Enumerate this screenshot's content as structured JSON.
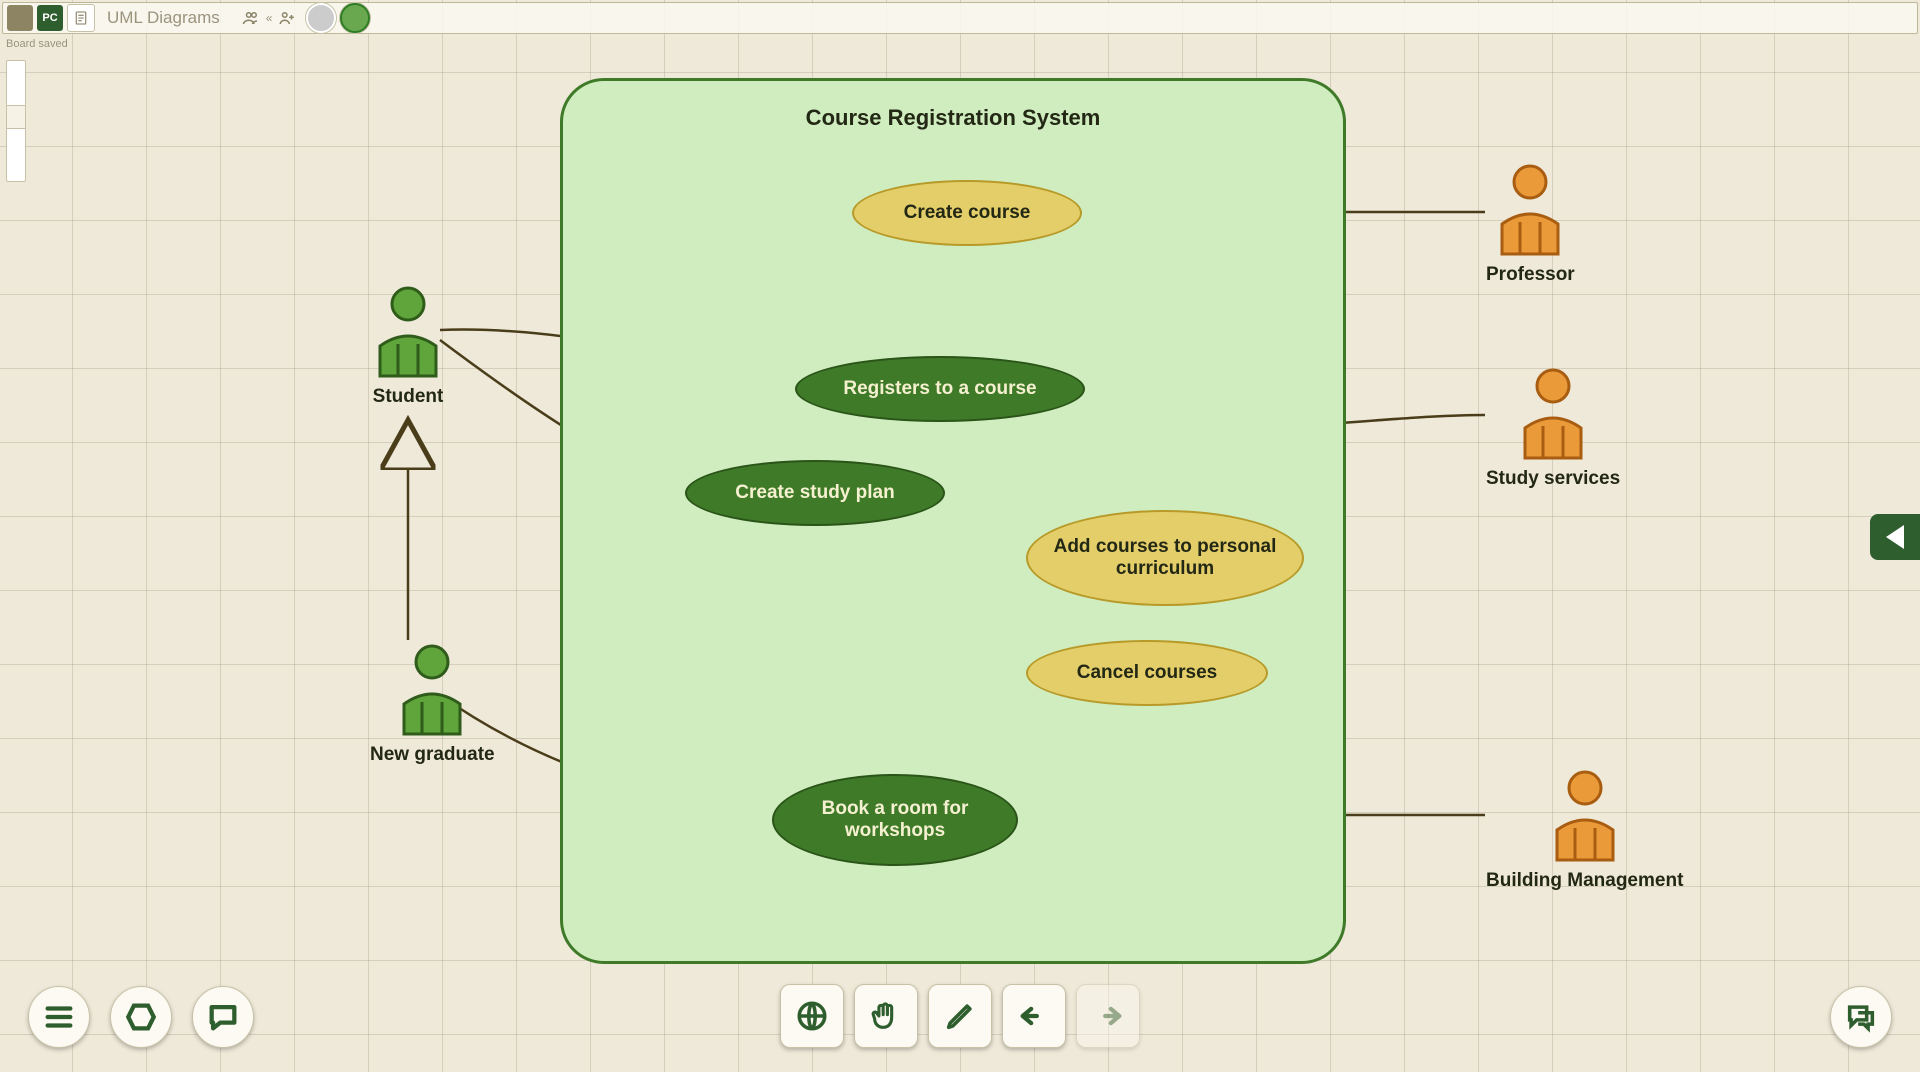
{
  "header": {
    "avatar1_initials": "",
    "avatar2_initials": "PC",
    "board_title": "UML Diagrams",
    "status": "Board saved"
  },
  "diagram": {
    "system_title": "Course Registration System",
    "actors": {
      "student": "Student",
      "new_graduate": "New graduate",
      "professor": "Professor",
      "study_services": "Study services",
      "building_mgmt": "Building Management"
    },
    "use_cases": {
      "create_course": "Create course",
      "registers_course": "Registers to a course",
      "create_study_plan": "Create study plan",
      "add_courses": "Add courses to personal curriculum",
      "cancel_courses": "Cancel courses",
      "book_room": "Book a room for workshops"
    }
  },
  "colors": {
    "system_border": "#3e7a28",
    "system_fill": "#d0edc0",
    "uc_yellow_fill": "#e4ce6a",
    "uc_yellow_stroke": "#b89a28",
    "uc_green_fill": "#3e7a28",
    "uc_green_stroke": "#2a5418",
    "actor_green": "#4f8c2f",
    "actor_orange": "#e08a2a",
    "edge": "#4a3d1a"
  }
}
